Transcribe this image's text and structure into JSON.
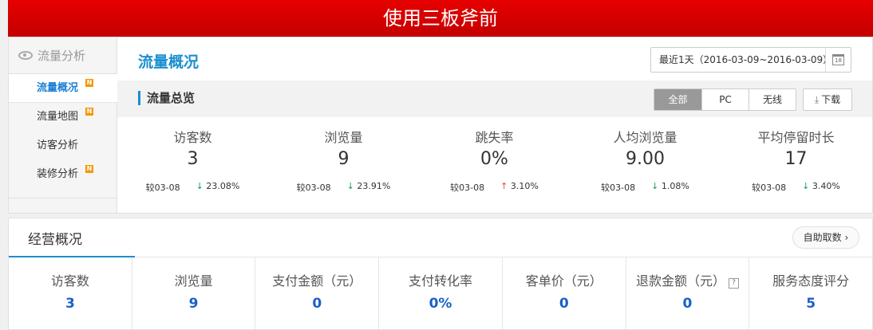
{
  "header": {
    "title": "使用三板斧前"
  },
  "sidebar": {
    "heading": "流量分析",
    "items": [
      {
        "label": "流量概况",
        "badge": "N"
      },
      {
        "label": "流量地图",
        "badge": "N"
      },
      {
        "label": "访客分析",
        "badge": ""
      },
      {
        "label": "装修分析",
        "badge": "N"
      }
    ]
  },
  "main": {
    "title": "流量概况",
    "date_range": "最近1天（2016-03-09~2016-03-09）",
    "calendar_day": "18",
    "section_title": "流量总览",
    "segments": [
      "全部",
      "PC",
      "无线"
    ],
    "download_label": "下载",
    "stats": [
      {
        "label": "访客数",
        "value": "3",
        "compare": "较03-08",
        "change": "23.08%",
        "dir": "down"
      },
      {
        "label": "浏览量",
        "value": "9",
        "compare": "较03-08",
        "change": "23.91%",
        "dir": "down"
      },
      {
        "label": "跳失率",
        "value": "0%",
        "compare": "较03-08",
        "change": "3.10%",
        "dir": "up"
      },
      {
        "label": "人均浏览量",
        "value": "9.00",
        "compare": "较03-08",
        "change": "1.08%",
        "dir": "down"
      },
      {
        "label": "平均停留时长",
        "value": "17",
        "compare": "较03-08",
        "change": "3.40%",
        "dir": "down"
      }
    ]
  },
  "business": {
    "title": "经营概况",
    "button": "自助取数",
    "metrics": [
      {
        "label": "访客数",
        "value": "3"
      },
      {
        "label": "浏览量",
        "value": "9"
      },
      {
        "label": "支付金额（元）",
        "value": "0"
      },
      {
        "label": "支付转化率",
        "value": "0%"
      },
      {
        "label": "客单价（元）",
        "value": "0"
      },
      {
        "label": "退款金额（元）",
        "value": "0"
      },
      {
        "label": "服务态度评分",
        "value": "5"
      }
    ]
  },
  "colors": {
    "brand_red": "#d90000",
    "accent_blue": "#1a8fd0",
    "up": "#e34a3a",
    "down": "#1aa050",
    "badge": "#f39800"
  }
}
